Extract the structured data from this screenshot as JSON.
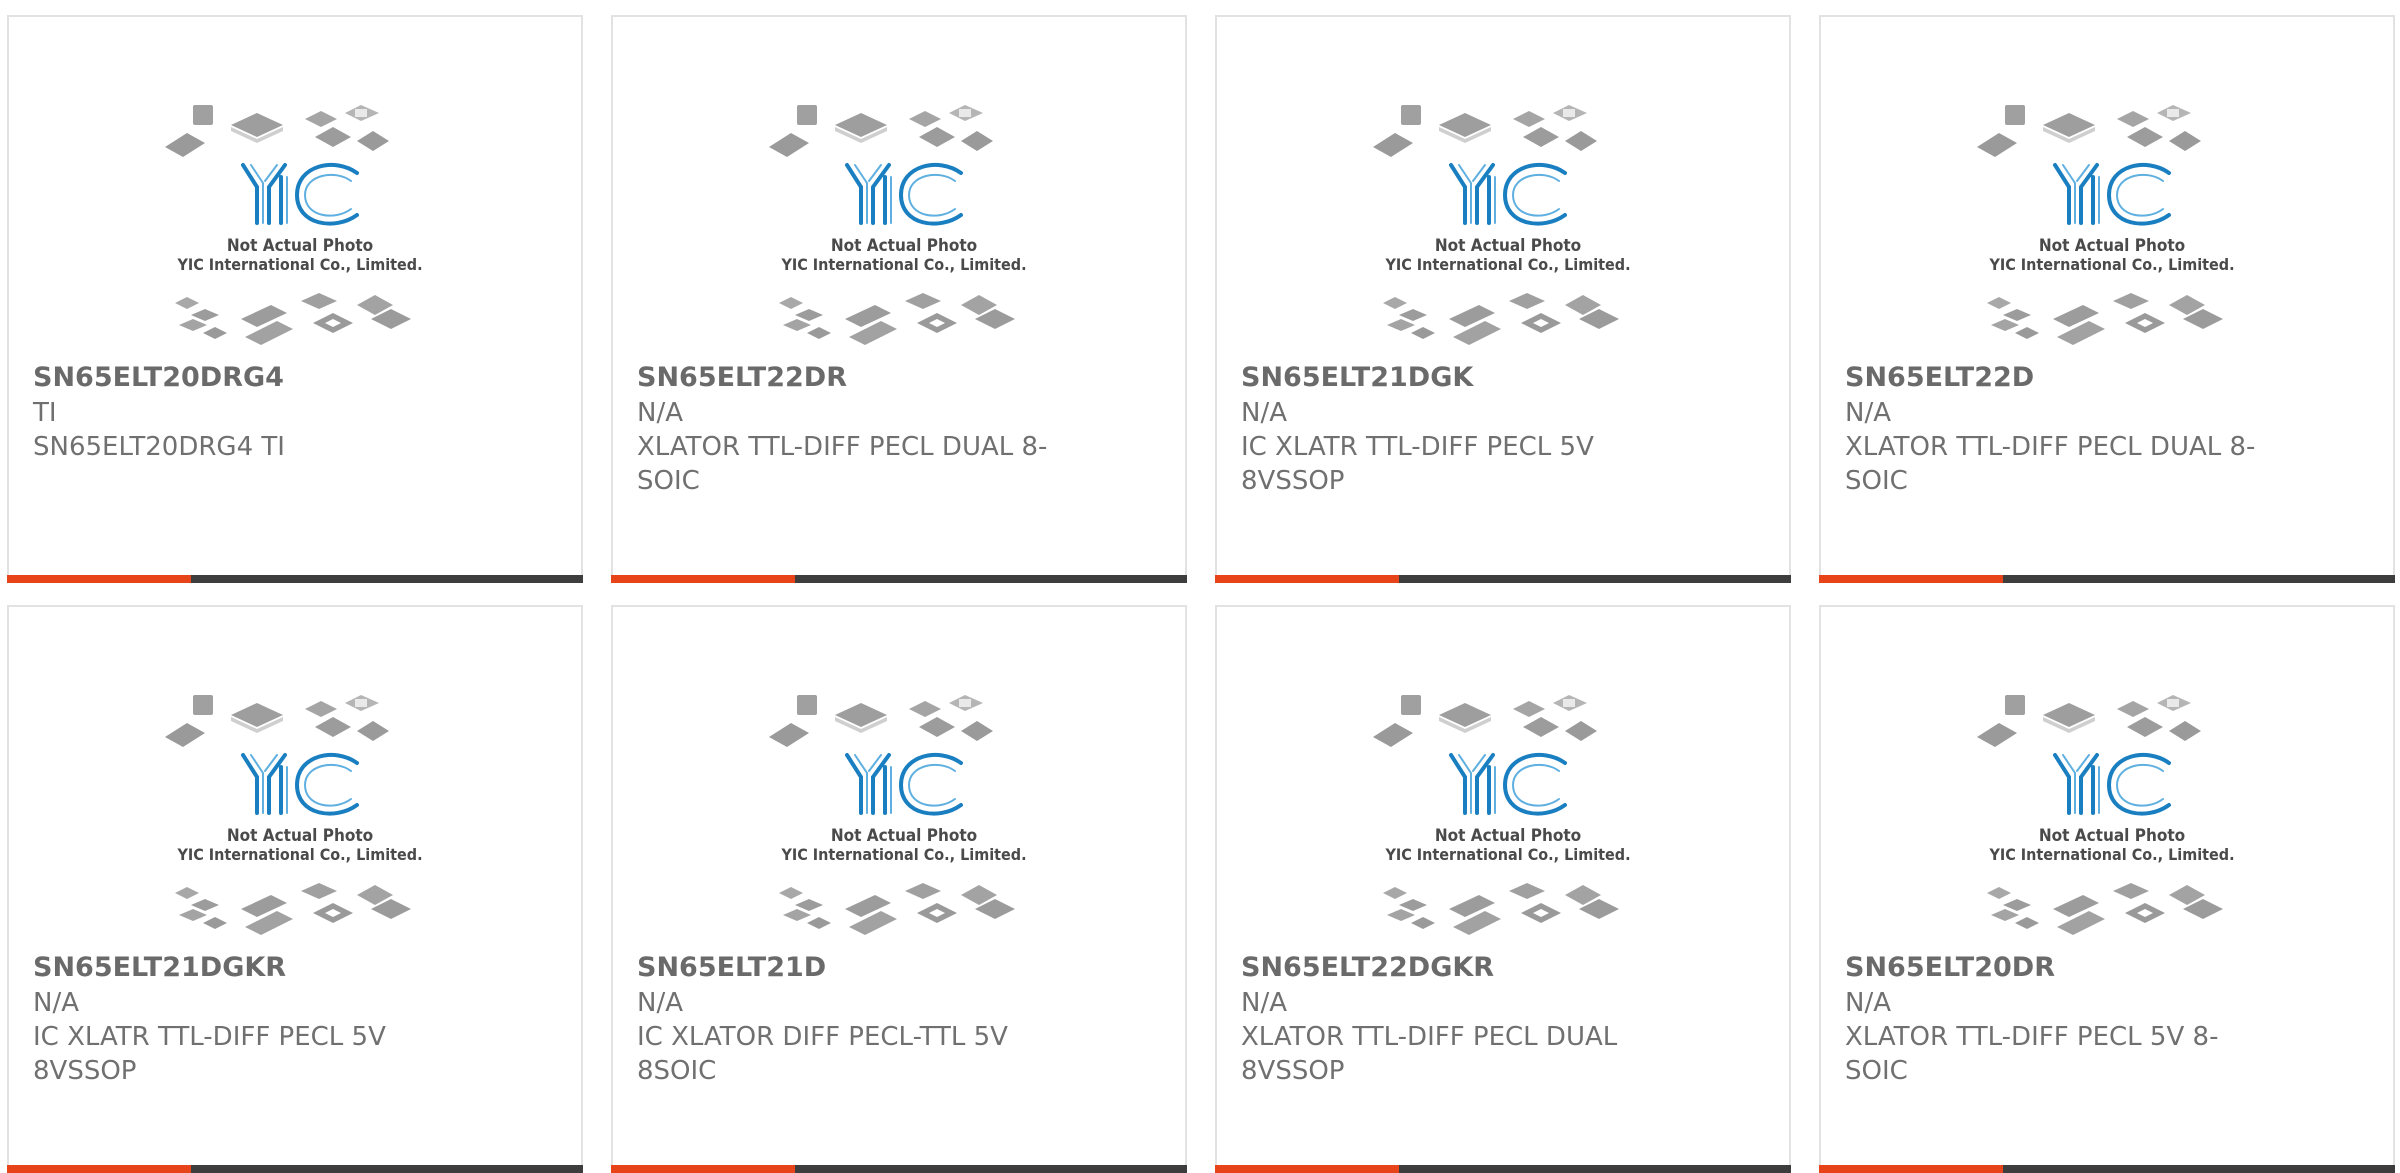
{
  "thumbnail": {
    "logo_text": "YIC",
    "note_line1": "Not Actual Photo",
    "note_line2": "YIC International Co., Limited."
  },
  "colors": {
    "accent": "#e8441a",
    "bar": "#3d3d3d",
    "logo": "#1a7fc1"
  },
  "products": [
    {
      "part_number": "SN65ELT20DRG4",
      "manufacturer": "TI",
      "description": "SN65ELT20DRG4 TI"
    },
    {
      "part_number": "SN65ELT22DR",
      "manufacturer": "N/A",
      "description": "XLATOR TTL-DIFF PECL DUAL 8-SOIC"
    },
    {
      "part_number": "SN65ELT21DGK",
      "manufacturer": "N/A",
      "description": "IC XLATR TTL-DIFF PECL 5V 8VSSOP"
    },
    {
      "part_number": "SN65ELT22D",
      "manufacturer": "N/A",
      "description": "XLATOR TTL-DIFF PECL DUAL 8-SOIC"
    },
    {
      "part_number": "SN65ELT21DGKR",
      "manufacturer": "N/A",
      "description": "IC XLATR TTL-DIFF PECL 5V 8VSSOP"
    },
    {
      "part_number": "SN65ELT21D",
      "manufacturer": "N/A",
      "description": "IC XLATOR DIFF PECL-TTL 5V 8SOIC"
    },
    {
      "part_number": "SN65ELT22DGKR",
      "manufacturer": "N/A",
      "description": "XLATOR TTL-DIFF PECL DUAL 8VSSOP"
    },
    {
      "part_number": "SN65ELT20DR",
      "manufacturer": "N/A",
      "description": "XLATOR TTL-DIFF PECL 5V 8-SOIC"
    }
  ]
}
